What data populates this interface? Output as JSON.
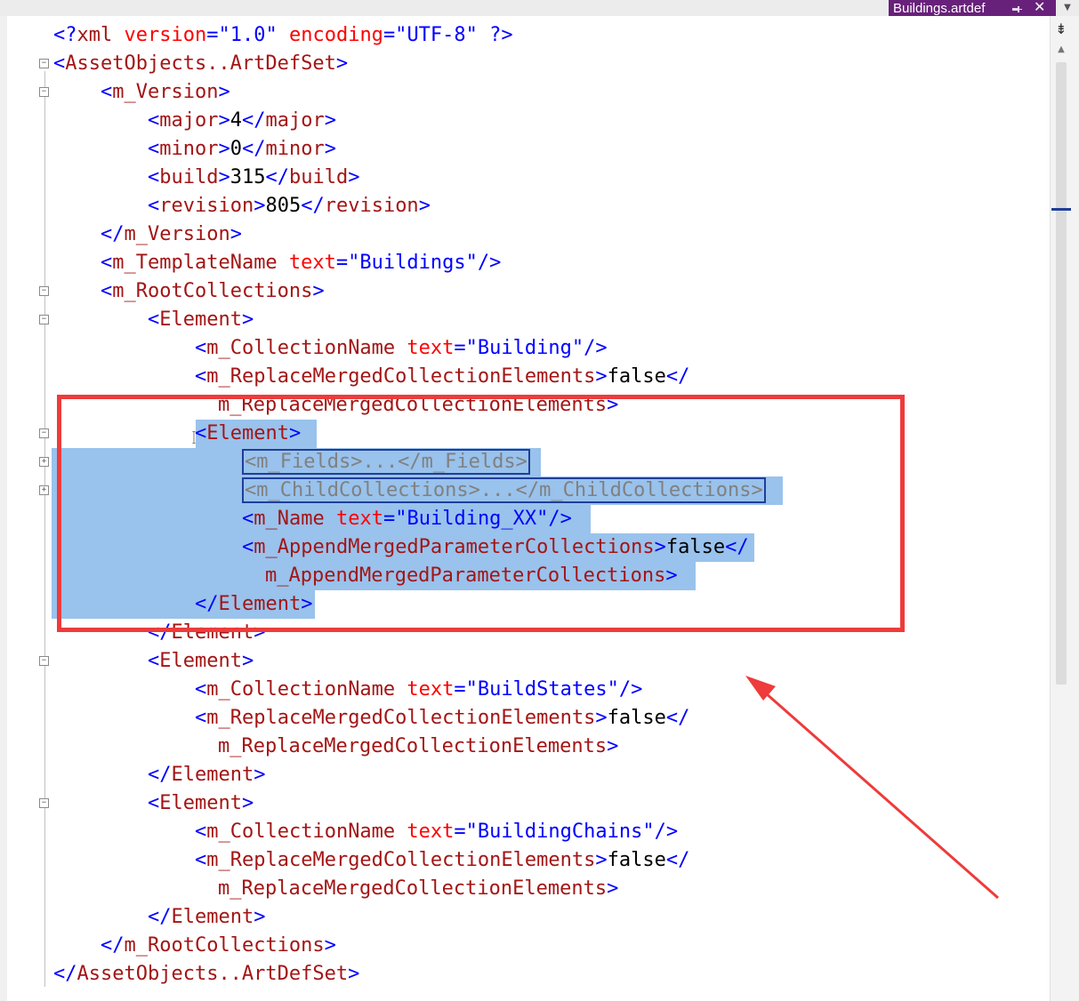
{
  "tab": {
    "label": "Buildings.artdef",
    "pin_icon": "pin-icon",
    "close_icon": "close-icon",
    "close_glyph": "✕",
    "dropdown_glyph": "▼"
  },
  "scrollbar": {
    "split_glyph": "⇟",
    "up_glyph": "▲"
  },
  "editor": {
    "lines": {
      "l1": {
        "open": "<?",
        "tag": "xml",
        "attr1": " version",
        "eq1": "=\"",
        "val1": "1.0",
        "q1": "\" ",
        "attr2": "encoding",
        "eq2": "=\"",
        "val2": "UTF-8",
        "end": "\" ?>"
      },
      "l2": {
        "open": "<",
        "tag": "AssetObjects..ArtDefSet",
        "close": ">"
      },
      "l3": {
        "open": "<",
        "tag": "m_Version",
        "close": ">"
      },
      "l4": {
        "open": "<",
        "tag": "major",
        "close": ">",
        "text": "4",
        "open2": "</",
        "tag2": "major",
        "close2": ">"
      },
      "l5": {
        "open": "<",
        "tag": "minor",
        "close": ">",
        "text": "0",
        "open2": "</",
        "tag2": "minor",
        "close2": ">"
      },
      "l6": {
        "open": "<",
        "tag": "build",
        "close": ">",
        "text": "315",
        "open2": "</",
        "tag2": "build",
        "close2": ">"
      },
      "l7": {
        "open": "<",
        "tag": "revision",
        "close": ">",
        "text": "805",
        "open2": "</",
        "tag2": "revision",
        "close2": ">"
      },
      "l8": {
        "open": "</",
        "tag": "m_Version",
        "close": ">"
      },
      "l9": {
        "open": "<",
        "tag": "m_TemplateName",
        "attr": " text",
        "eq": "=\"",
        "val": "Buildings",
        "end": "\"/>"
      },
      "l10": {
        "open": "<",
        "tag": "m_RootCollections",
        "close": ">"
      },
      "l11": {
        "open": "<",
        "tag": "Element",
        "close": ">"
      },
      "l12": {
        "open": "<",
        "tag": "m_CollectionName",
        "attr": " text",
        "eq": "=\"",
        "val": "Building",
        "end": "\"/>"
      },
      "l13": {
        "open": "<",
        "tag": "m_ReplaceMergedCollectionElements",
        "close": ">",
        "text": "false",
        "open2": "</"
      },
      "l14": {
        "tag": "m_ReplaceMergedCollectionElements",
        "close": ">"
      },
      "l15": {
        "open": "<",
        "tag": "Element",
        "close": ">"
      },
      "l16": {
        "collapsed": "<m_Fields>...</m_Fields>"
      },
      "l17": {
        "collapsed": "<m_ChildCollections>...</m_ChildCollections>"
      },
      "l18": {
        "open": "<",
        "tag": "m_Name",
        "attr": " text",
        "eq": "=\"",
        "val": "Building_XX",
        "end": "\"/>"
      },
      "l19": {
        "open": "<",
        "tag": "m_AppendMergedParameterCollections",
        "close": ">",
        "text": "false",
        "open2": "</"
      },
      "l20": {
        "tag": "m_AppendMergedParameterCollections",
        "close": ">"
      },
      "l21": {
        "open": "</",
        "tag": "Element",
        "close": ">"
      },
      "l22": {
        "open": "</",
        "tag": "Element",
        "close": ">"
      },
      "l23": {
        "open": "<",
        "tag": "Element",
        "close": ">"
      },
      "l24": {
        "open": "<",
        "tag": "m_CollectionName",
        "attr": " text",
        "eq": "=\"",
        "val": "BuildStates",
        "end": "\"/>"
      },
      "l25": {
        "open": "<",
        "tag": "m_ReplaceMergedCollectionElements",
        "close": ">",
        "text": "false",
        "open2": "</"
      },
      "l26": {
        "tag": "m_ReplaceMergedCollectionElements",
        "close": ">"
      },
      "l27": {
        "open": "</",
        "tag": "Element",
        "close": ">"
      },
      "l28": {
        "open": "<",
        "tag": "Element",
        "close": ">"
      },
      "l29": {
        "open": "<",
        "tag": "m_CollectionName",
        "attr": " text",
        "eq": "=\"",
        "val": "BuildingChains",
        "end": "\"/>"
      },
      "l30": {
        "open": "<",
        "tag": "m_ReplaceMergedCollectionElements",
        "close": ">",
        "text": "false",
        "open2": "</"
      },
      "l31": {
        "tag": "m_ReplaceMergedCollectionElements",
        "close": ">"
      },
      "l32": {
        "open": "</",
        "tag": "Element",
        "close": ">"
      },
      "l33": {
        "open": "</",
        "tag": "m_RootCollections",
        "close": ">"
      },
      "l34": {
        "open": "</",
        "tag": "AssetObjects..ArtDefSet",
        "close": ">"
      }
    },
    "fold_minus": "−",
    "fold_plus": "+"
  },
  "annotation": {
    "highlight": "red-rectangle",
    "pointer": "red-arrow",
    "color": "#ee3b3b"
  }
}
